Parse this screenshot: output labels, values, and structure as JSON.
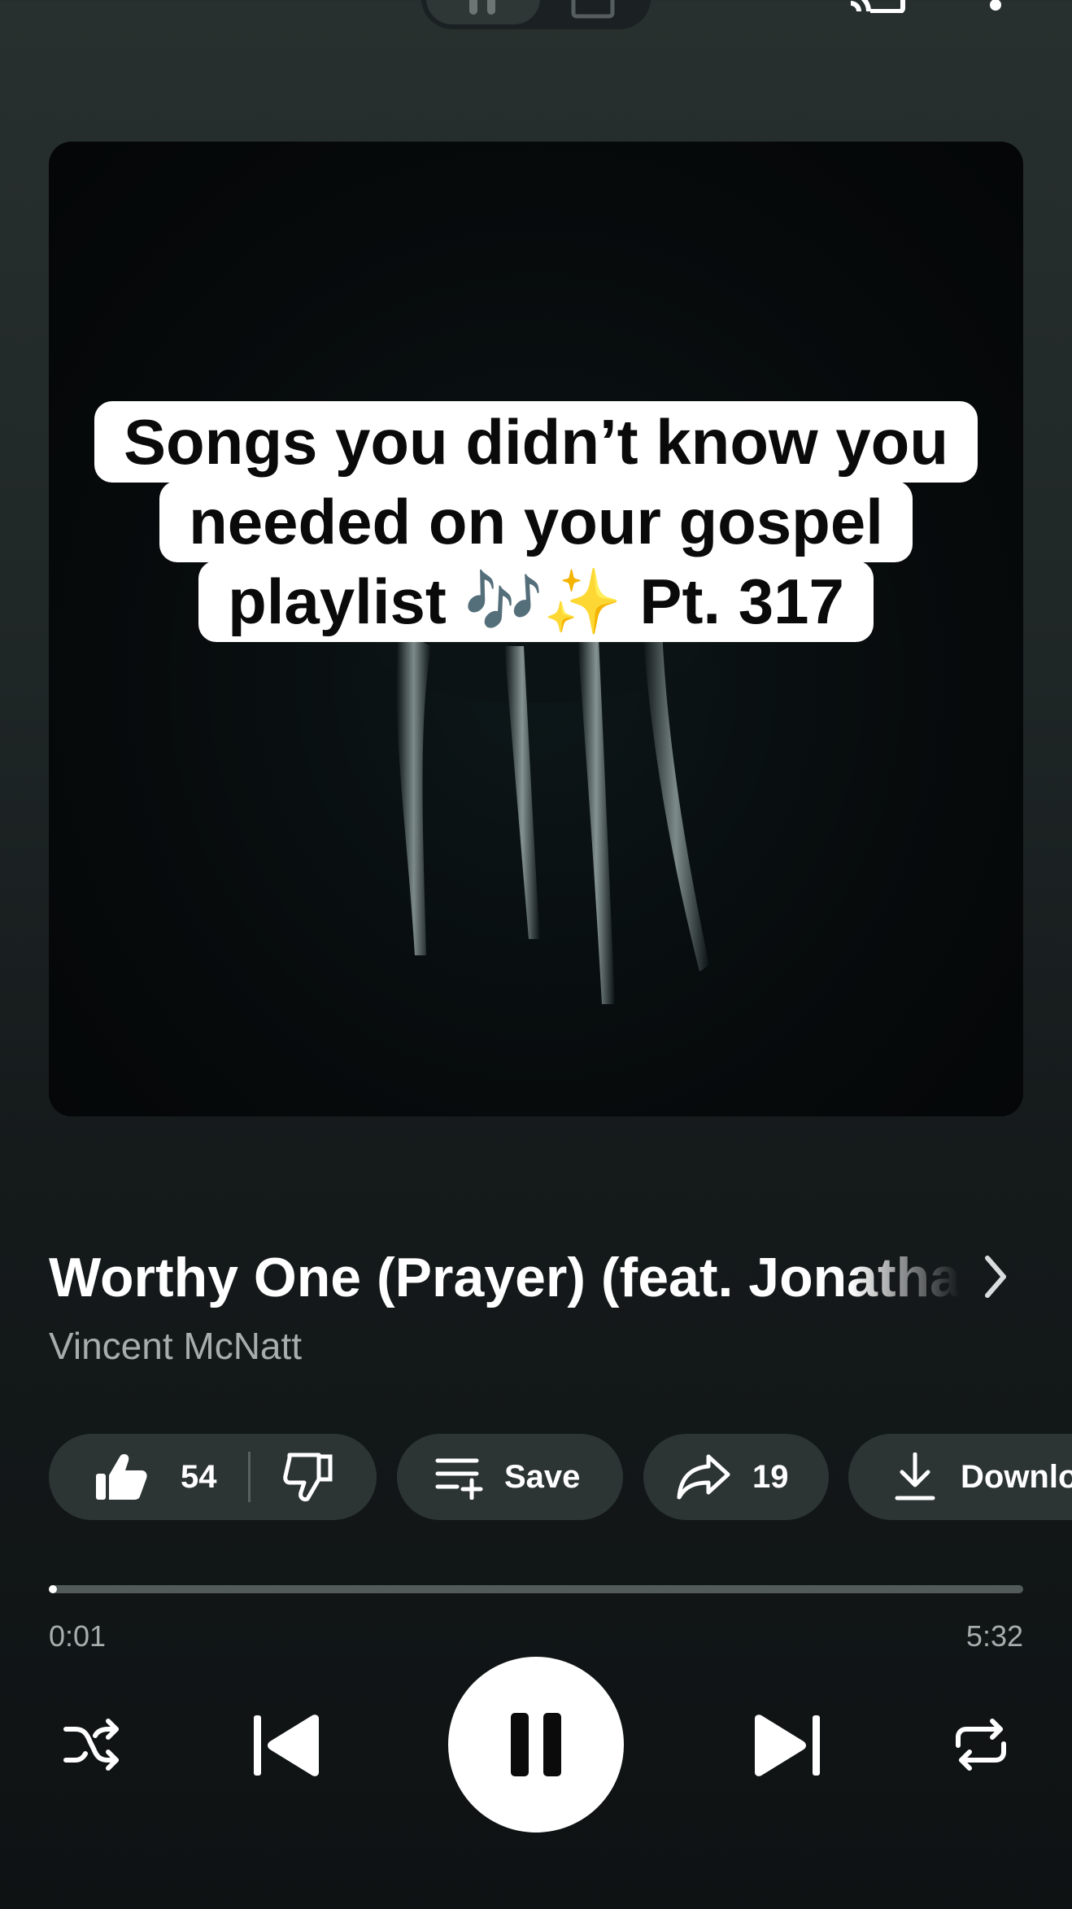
{
  "artwork": {
    "caption_lines": [
      "Songs you didn’t know you",
      "needed on your gospel",
      "playlist 🎶✨ Pt. 317"
    ]
  },
  "track": {
    "title": "Worthy One (Prayer) (feat. Jonathan McReynolds)",
    "artist": "Vincent McNatt"
  },
  "actions": {
    "like_count": "54",
    "save_label": "Save",
    "share_count": "19",
    "download_label": "Download"
  },
  "player": {
    "elapsed": "0:01",
    "duration": "5:32",
    "progress_fraction": 0.003
  },
  "icons": [
    "cast-icon",
    "more-icon",
    "thumbs-up-icon",
    "thumbs-down-icon",
    "playlist-add-icon",
    "share-icon",
    "download-icon",
    "shuffle-icon",
    "previous-icon",
    "pause-icon",
    "next-icon",
    "repeat-icon",
    "chevron-right-icon"
  ]
}
